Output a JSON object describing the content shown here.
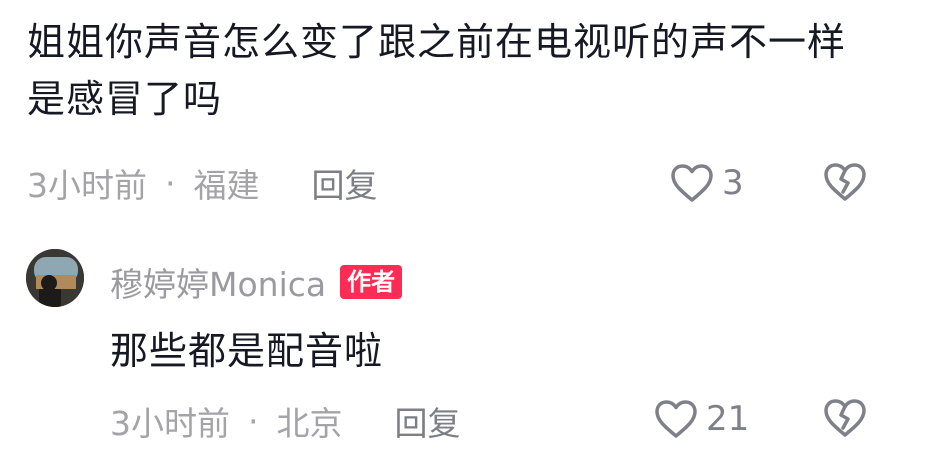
{
  "comment": {
    "text": "姐姐你声音怎么变了跟之前在电视听的声不一样是感冒了吗",
    "time": "3小时前",
    "separator": "·",
    "location": "福建",
    "reply_label": "回复",
    "like_count": "3",
    "like_icon": "heart-outline-icon",
    "dislike_icon": "broken-heart-icon"
  },
  "reply": {
    "username": "穆婷婷Monica",
    "badge": "作者",
    "text": "那些都是配音啦",
    "time": "3小时前",
    "separator": "·",
    "location": "北京",
    "reply_label": "回复",
    "like_count": "21",
    "like_icon": "heart-outline-icon",
    "dislike_icon": "broken-heart-icon"
  },
  "colors": {
    "text": "#161823",
    "meta": "#a3a3a8",
    "badge": "#fe2c55"
  }
}
